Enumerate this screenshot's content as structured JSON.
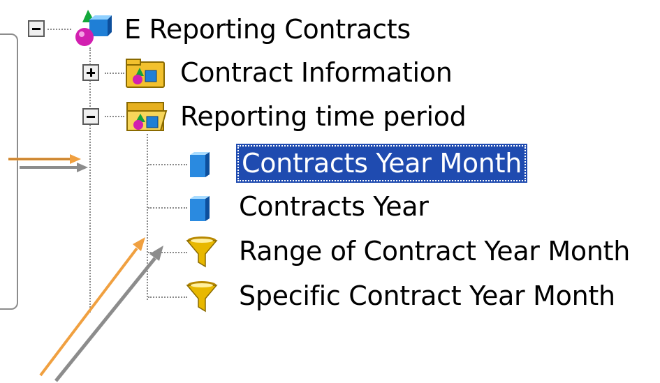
{
  "tree": {
    "root": {
      "label": "E Reporting Contracts",
      "expanded": true,
      "icon": "universe-icon"
    },
    "children": [
      {
        "label": "Contract Information",
        "expanded": false,
        "icon": "class-folder-icon"
      },
      {
        "label": "Reporting time period",
        "expanded": true,
        "icon": "class-folder-open-icon",
        "children": [
          {
            "label": "Contracts Year Month",
            "icon": "dimension-cube-icon",
            "selected": true
          },
          {
            "label": "Contracts Year",
            "icon": "dimension-cube-icon",
            "selected": false
          },
          {
            "label": "Range of Contract Year Month",
            "icon": "filter-funnel-icon",
            "selected": false
          },
          {
            "label": "Specific Contract Year Month",
            "icon": "filter-funnel-icon",
            "selected": false
          }
        ]
      }
    ]
  },
  "colors": {
    "selection": "#1f4bb0",
    "arrow_orange": "#f0a040",
    "arrow_gray": "#8c8c8c",
    "funnel": "#d9a800"
  }
}
